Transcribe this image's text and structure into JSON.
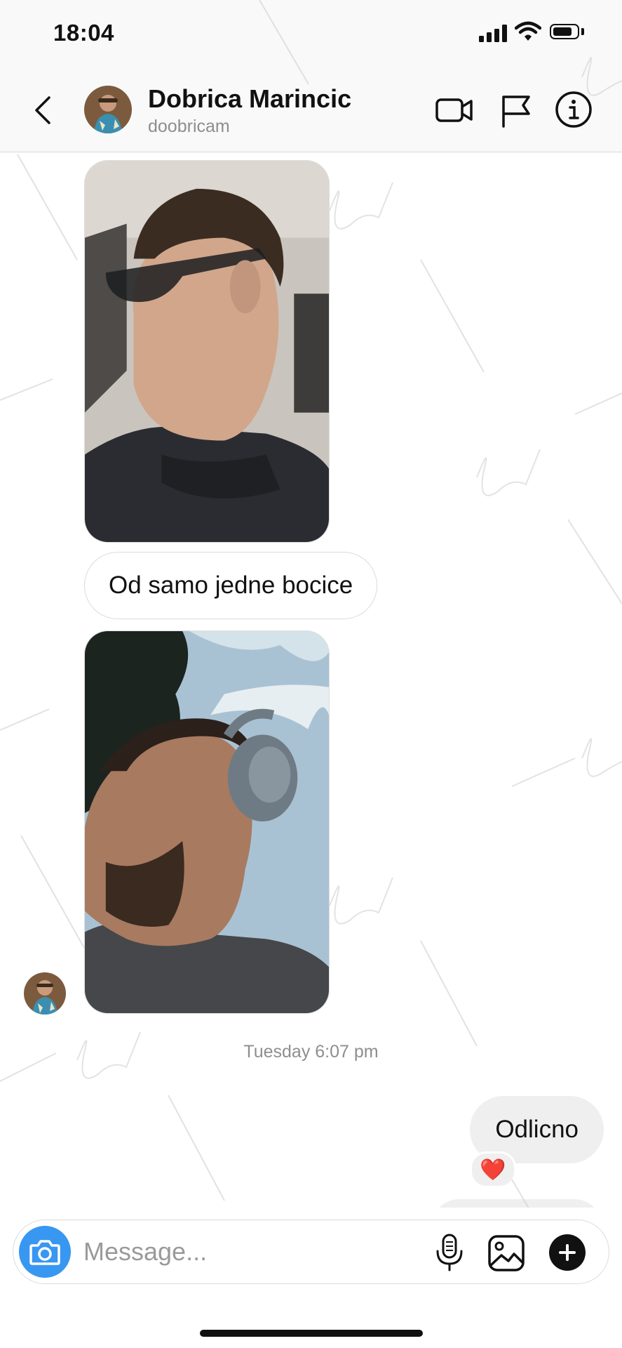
{
  "status_bar": {
    "time": "18:04",
    "icons": [
      "cellular-signal-icon",
      "wifi-icon",
      "battery-icon"
    ]
  },
  "header": {
    "back_icon": "chevron-left-icon",
    "contact_name": "Dobrica Marincic",
    "contact_username": "doobricam",
    "actions": [
      "video-call-icon",
      "flag-icon",
      "info-icon"
    ]
  },
  "conversation": {
    "messages": [
      {
        "type": "photo",
        "direction": "incoming",
        "subject": "man in sunglasses, profile, in car"
      },
      {
        "type": "text",
        "direction": "incoming",
        "text": "Od samo jedne bocice"
      },
      {
        "type": "photo",
        "direction": "incoming",
        "subject": "man with headphones, low angle, sky"
      }
    ],
    "timestamp": "Tuesday 6:07 pm",
    "outgoing": {
      "text": "Odlicno",
      "reaction": "❤️"
    }
  },
  "composer": {
    "placeholder": "Message...",
    "icons": [
      "camera-icon",
      "microphone-icon",
      "gallery-icon",
      "plus-icon"
    ]
  },
  "colors": {
    "accent_blue": "#3897f0",
    "header_bg": "#f9f9f9",
    "outgoing_bubble": "#efefef",
    "secondary_text": "#8e8e8e"
  }
}
